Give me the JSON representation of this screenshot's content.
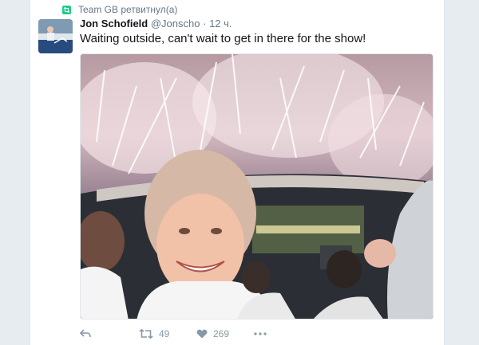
{
  "retweet_context": {
    "text": "Team GB ретвитнул(а)",
    "icon": "retweet-icon"
  },
  "tweet": {
    "author_name": "Jon Schofield",
    "author_handle": "@Jonscho",
    "separator": "·",
    "timestamp": "12 ч.",
    "text": "Waiting outside, can't wait to get in there for the show!",
    "photo_alt": "Selfie outside stadium with fireworks"
  },
  "actions": {
    "reply_icon": "reply-icon",
    "retweet_count": "49",
    "like_count": "269",
    "more_icon": "more-icon"
  },
  "colors": {
    "retweet_green": "#19cf86",
    "text_primary": "#14171a",
    "text_secondary": "#657786",
    "action_grey": "#8899a6",
    "page_bg": "#e6ecf0"
  }
}
